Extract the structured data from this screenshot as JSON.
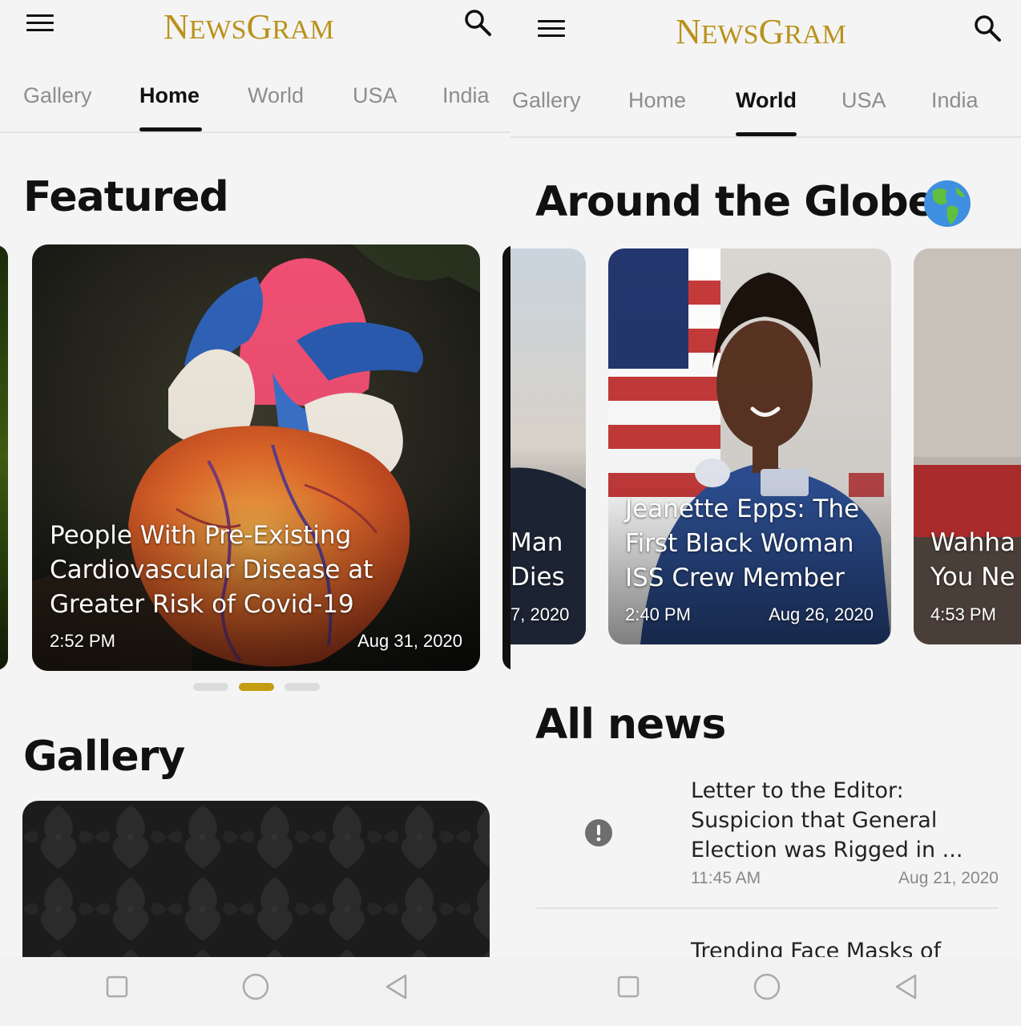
{
  "left": {
    "app": {
      "logo": "NEWSGRAM",
      "logo_first": "N",
      "logo_mid": "EWS",
      "logo_g": "G",
      "logo_rest": "RAM"
    },
    "tabs": [
      {
        "label": "Gallery",
        "active": false
      },
      {
        "label": "Home",
        "active": true
      },
      {
        "label": "World",
        "active": false
      },
      {
        "label": "USA",
        "active": false
      },
      {
        "label": "India",
        "active": false
      }
    ],
    "featured": {
      "title": "Featured",
      "card": {
        "headline": "People With Pre-Existing\nCardiovascular Disease at\nGreater Risk of Covid-19",
        "time": "2:52 PM",
        "date": "Aug 31, 2020"
      },
      "carousel": {
        "count": 3,
        "active_index": 1
      }
    },
    "gallery": {
      "title": "Gallery"
    }
  },
  "right": {
    "app": {
      "logo": "NEWSGRAM",
      "logo_first": "N",
      "logo_mid": "EWS",
      "logo_g": "G",
      "logo_rest": "RAM"
    },
    "tabs": [
      {
        "label": "Gallery",
        "active": false
      },
      {
        "label": "Home",
        "active": false
      },
      {
        "label": "World",
        "active": true
      },
      {
        "label": "USA",
        "active": false
      },
      {
        "label": "India",
        "active": false
      }
    ],
    "globe": {
      "title": "Around the Globe",
      "emoji": "🌎",
      "cards": [
        {
          "headline": "Man\nDies",
          "date": "7, 2020"
        },
        {
          "headline": "Jeanette Epps: The\nFirst Black Woman\nISS Crew Member",
          "time": "2:40 PM",
          "date": "Aug 26, 2020"
        },
        {
          "headline": "Wahha\nYou Ne",
          "time": "4:53 PM"
        }
      ]
    },
    "all_news": {
      "title": "All news",
      "items": [
        {
          "headline": "Letter to the Editor:\nSuspicion that General\nElection was Rigged in ...",
          "time": "11:45 AM",
          "date": "Aug 21, 2020"
        },
        {
          "headline": "Trending Face Masks of"
        }
      ]
    }
  },
  "colors": {
    "brand": "#b9921b",
    "dot_active": "#c49b12",
    "background": "#f4f4f4"
  },
  "icons": [
    "menu-icon",
    "search-icon",
    "alert-icon",
    "square-nav-icon",
    "circle-nav-icon",
    "back-triangle-icon"
  ]
}
